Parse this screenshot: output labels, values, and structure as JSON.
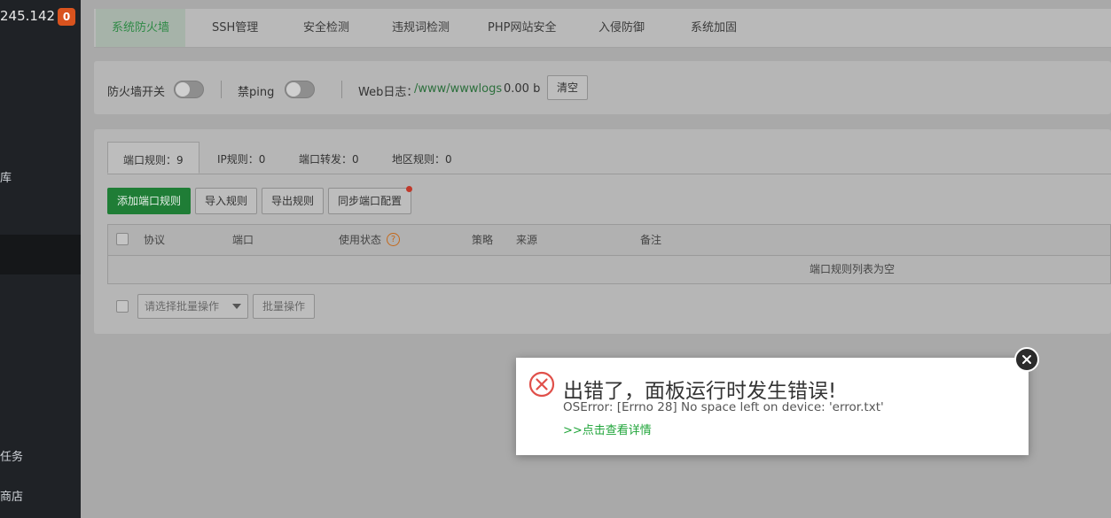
{
  "sidebar": {
    "ip": "245.142",
    "badge": "0",
    "items": [
      "库",
      "任务",
      "商店"
    ]
  },
  "tabs": [
    "系统防火墙",
    "SSH管理",
    "安全检测",
    "违规词检测",
    "PHP网站安全",
    "入侵防御",
    "系统加固"
  ],
  "settings": {
    "firewall_switch_label": "防火墙开关",
    "firewall_switch_on": false,
    "ping_label": "禁ping",
    "ping_switch_on": false,
    "weblog_label": "Web日志：",
    "weblog_path": "/www/wwwlogs",
    "weblog_size": "0.00 b",
    "clear_button": "清空"
  },
  "subtabs": [
    "端口规则：9",
    "IP规则：0",
    "端口转发：0",
    "地区规则：0"
  ],
  "toolbar": {
    "add": "添加端口规则",
    "import": "导入规则",
    "export": "导出规则",
    "sync": "同步端口配置"
  },
  "table": {
    "headers": [
      "协议",
      "端口",
      "使用状态",
      "策略",
      "来源",
      "备注"
    ],
    "help_icon": "?",
    "empty_text": "端口规则列表为空"
  },
  "batch": {
    "select_placeholder": "请选择批量操作",
    "button": "批量操作"
  },
  "modal": {
    "title": "出错了，面板运行时发生错误!",
    "message": "OSError: [Errno 28] No space left on device: 'error.txt'",
    "link": ">>点击查看详情"
  },
  "colors": {
    "accent_green": "#20a53a",
    "error_red": "#e0504a",
    "badge_orange": "#d9531e"
  }
}
